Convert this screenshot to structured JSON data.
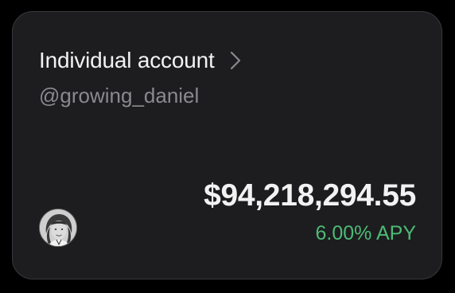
{
  "account": {
    "title": "Individual account",
    "handle": "@growing_daniel",
    "balance": "$94,218,294.55",
    "apy": "6.00% APY"
  },
  "icons": {
    "chevron": "chevron-right-icon",
    "avatar": "avatar"
  },
  "colors": {
    "background": "#000000",
    "card": "#1d1d20",
    "card_border": "#38383c",
    "primary_text": "#f2f2f2",
    "secondary_text": "#8a8a8e",
    "positive": "#4dbb74"
  }
}
